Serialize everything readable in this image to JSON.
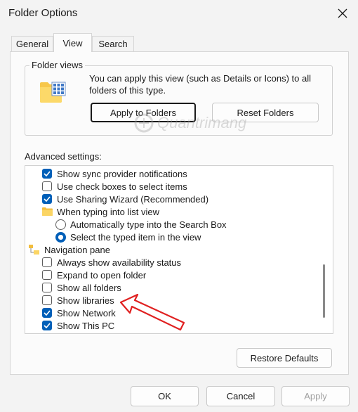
{
  "window": {
    "title": "Folder Options"
  },
  "tabs": [
    {
      "label": "General"
    },
    {
      "label": "View"
    },
    {
      "label": "Search"
    }
  ],
  "folder_views": {
    "title": "Folder views",
    "description_line1": "You can apply this view (such as Details or Icons) to all",
    "description_line2": "folders of this type.",
    "apply_button": "Apply to Folders",
    "reset_button": "Reset Folders"
  },
  "advanced": {
    "label": "Advanced settings:",
    "items": [
      {
        "type": "checkbox",
        "checked": true,
        "label": "Show sync provider notifications"
      },
      {
        "type": "checkbox",
        "checked": false,
        "label": "Use check boxes to select items"
      },
      {
        "type": "checkbox",
        "checked": true,
        "label": "Use Sharing Wizard (Recommended)"
      },
      {
        "type": "folder",
        "label": "When typing into list view"
      },
      {
        "type": "radio",
        "checked": false,
        "label": "Automatically type into the Search Box"
      },
      {
        "type": "radio",
        "checked": true,
        "label": "Select the typed item in the view"
      },
      {
        "type": "group",
        "label": "Navigation pane"
      },
      {
        "type": "checkbox",
        "checked": false,
        "label": "Always show availability status"
      },
      {
        "type": "checkbox",
        "checked": false,
        "label": "Expand to open folder"
      },
      {
        "type": "checkbox",
        "checked": false,
        "label": "Show all folders"
      },
      {
        "type": "checkbox",
        "checked": false,
        "label": "Show libraries"
      },
      {
        "type": "checkbox",
        "checked": true,
        "label": "Show Network"
      },
      {
        "type": "checkbox",
        "checked": true,
        "label": "Show This PC"
      }
    ],
    "restore_button": "Restore Defaults"
  },
  "footer": {
    "ok": "OK",
    "cancel": "Cancel",
    "apply": "Apply"
  },
  "watermark": "Quantrimang",
  "colors": {
    "accent": "#005fb8",
    "annotation_arrow": "#e02020"
  }
}
